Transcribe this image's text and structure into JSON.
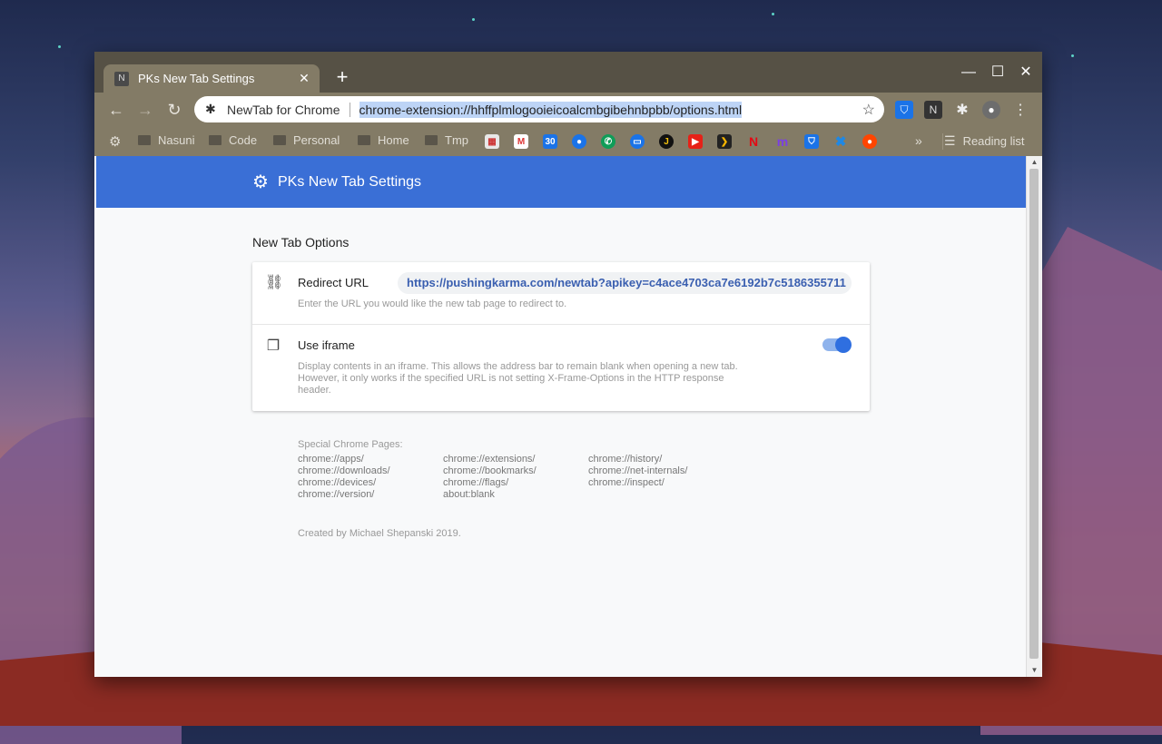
{
  "browser": {
    "tab_title": "PKs New Tab Settings",
    "tab_favicon_letter": "N",
    "omnibox_extension_name": "NewTab for Chrome",
    "omnibox_url": "chrome-extension://hhffplmlogooieicoalcmbgibehnbpbb/options.html"
  },
  "bookmarks": {
    "folders": [
      "Nasuni",
      "Code",
      "Personal",
      "Home",
      "Tmp"
    ],
    "overflow": "»",
    "reading_list": "Reading list"
  },
  "page": {
    "header_title": "PKs New Tab Settings",
    "section_title": "New Tab Options",
    "redirect": {
      "label": "Redirect URL",
      "value": "https://pushingkarma.com/newtab?apikey=c4ace4703ca7e6192b7c5186355711",
      "description": "Enter the URL you would like the new tab page to redirect to."
    },
    "iframe": {
      "label": "Use iframe",
      "enabled": true,
      "description_lines": [
        "Display contents in an iframe. This allows the address bar to remain blank when opening a new tab.",
        "However, it only works if the specified URL is not setting X-Frame-Options in the HTTP response",
        "header."
      ]
    },
    "special_title": "Special Chrome Pages:",
    "special_pages": [
      "chrome://apps/",
      "chrome://extensions/",
      "chrome://history/",
      "chrome://downloads/",
      "chrome://bookmarks/",
      "chrome://net-internals/",
      "chrome://devices/",
      "chrome://flags/",
      "chrome://inspect/",
      "chrome://version/",
      "about:blank"
    ],
    "footer": "Created by Michael Shepanski 2019."
  },
  "colors": {
    "header_blue": "#3a6fd6",
    "toggle_on": "#2f6fe0",
    "titlebar": "#565145",
    "toolbar": "#837b66"
  }
}
